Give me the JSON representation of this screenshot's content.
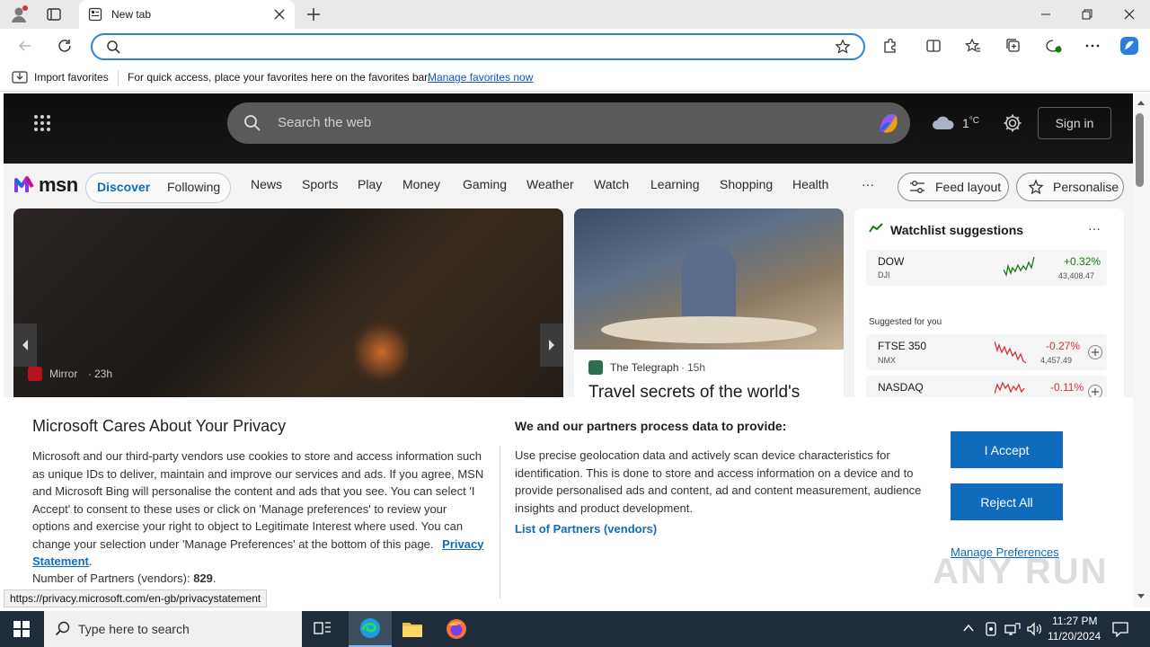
{
  "browser": {
    "tab_title": "New tab",
    "address_value": "",
    "favorites_bar": {
      "import_label": "Import favorites",
      "hint": "For quick access, place your favorites here on the favorites bar.",
      "manage_link": "Manage favorites now"
    },
    "status_url": "https://privacy.microsoft.com/en-gb/privacystatement"
  },
  "msn": {
    "search_placeholder": "Search the web",
    "weather_temp": "1",
    "weather_unit": "°C",
    "sign_in": "Sign in",
    "logo_text": "msn",
    "tabs": [
      "Discover",
      "Following"
    ],
    "nav": [
      "News",
      "Sports",
      "Play",
      "Money",
      "Gaming",
      "Weather",
      "Watch",
      "Learning",
      "Shopping",
      "Health"
    ],
    "more": "···",
    "feed_layout": "Feed layout",
    "personalise": "Personalise",
    "left_story": {
      "source": "Mirror",
      "age": "23h"
    },
    "mid_story": {
      "source": "The Telegraph",
      "age": "15h",
      "headline": "Travel secrets of the world's"
    },
    "watchlist": {
      "title": "Watchlist suggestions",
      "more": "···",
      "suggested_label": "Suggested for you",
      "stocks": [
        {
          "name": "DOW",
          "sub": "DJI",
          "change": "+0.32%",
          "price": "43,408.47",
          "color": "#107c10"
        },
        {
          "name": "FTSE 350",
          "sub": "NMX",
          "change": "-0.27%",
          "price": "4,457.49",
          "color": "#d13438"
        },
        {
          "name": "NASDAQ",
          "sub": "",
          "change": "-0.11%",
          "price": "",
          "color": "#d13438"
        }
      ]
    }
  },
  "privacy": {
    "title": "Microsoft Cares About Your Privacy",
    "body": "Microsoft and our third-party vendors use cookies to store and access information such as unique IDs to deliver, maintain and improve our services and ads. If you agree, MSN and Microsoft Bing will personalise the content and ads that you see. You can select 'I Accept' to consent to these uses or click on 'Manage preferences' to review your options and exercise your right to object to Legitimate Interest where used.  You can change your selection under 'Manage Preferences' at the bottom of this page.",
    "statement_link": "Privacy Statement",
    "partners_label": "Number of Partners (vendors):",
    "partners_count": "829",
    "right_title": "We and our partners process data to provide:",
    "right_body": "Use precise geolocation data and actively scan device characteristics for identification. This is done to store and access information on a device and to provide personalised ads and content, ad and content measurement, audience insights and product development.",
    "partners_link": "List of Partners (vendors)",
    "accept": "I Accept",
    "reject": "Reject All",
    "manage": "Manage Preferences"
  },
  "watermark": "ANY RUN",
  "taskbar": {
    "search_placeholder": "Type here to search",
    "time": "11:27 PM",
    "date": "11/20/2024"
  }
}
